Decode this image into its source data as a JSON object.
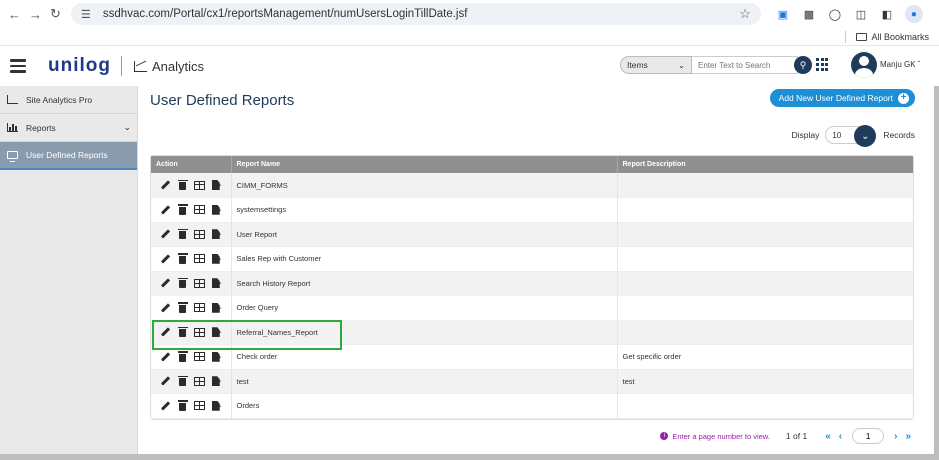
{
  "browser": {
    "url": "ssdhvac.com/Portal/cx1/reportsManagement/numUsersLoginTillDate.jsf",
    "bookmarks_label": "All Bookmarks"
  },
  "header": {
    "logo": "unilog",
    "app_name": "Analytics",
    "search_scope": "Items",
    "search_placeholder": "Enter Text to Search",
    "user_name": "Manju GK"
  },
  "sidebar": {
    "items": [
      {
        "label": "Site Analytics Pro"
      },
      {
        "label": "Reports"
      },
      {
        "label": "User Defined Reports"
      }
    ]
  },
  "main": {
    "title": "User Defined Reports",
    "add_button": "Add New User Defined Report",
    "display_label": "Display",
    "display_value": "10",
    "records_label": "Records",
    "columns": [
      "Action",
      "Report Name",
      "Report Description"
    ],
    "rows": [
      {
        "name": "CIMM_FORMS",
        "desc": ""
      },
      {
        "name": "systemsettings",
        "desc": ""
      },
      {
        "name": "User Report",
        "desc": ""
      },
      {
        "name": "Sales Rep with Customer",
        "desc": ""
      },
      {
        "name": "Search History Report",
        "desc": ""
      },
      {
        "name": "Order Query",
        "desc": ""
      },
      {
        "name": "Referral_Names_Report",
        "desc": ""
      },
      {
        "name": "Check order",
        "desc": "Get specific order"
      },
      {
        "name": "test",
        "desc": "test"
      },
      {
        "name": "Orders",
        "desc": ""
      }
    ],
    "pager": {
      "hint": "Enter a page number to view.",
      "current": "1",
      "of_label": "of",
      "total": "1",
      "input_value": "1"
    }
  },
  "colors": {
    "primary": "#1f3b5b",
    "accent": "#1d8fd6",
    "highlight": "#2eaa3d"
  }
}
